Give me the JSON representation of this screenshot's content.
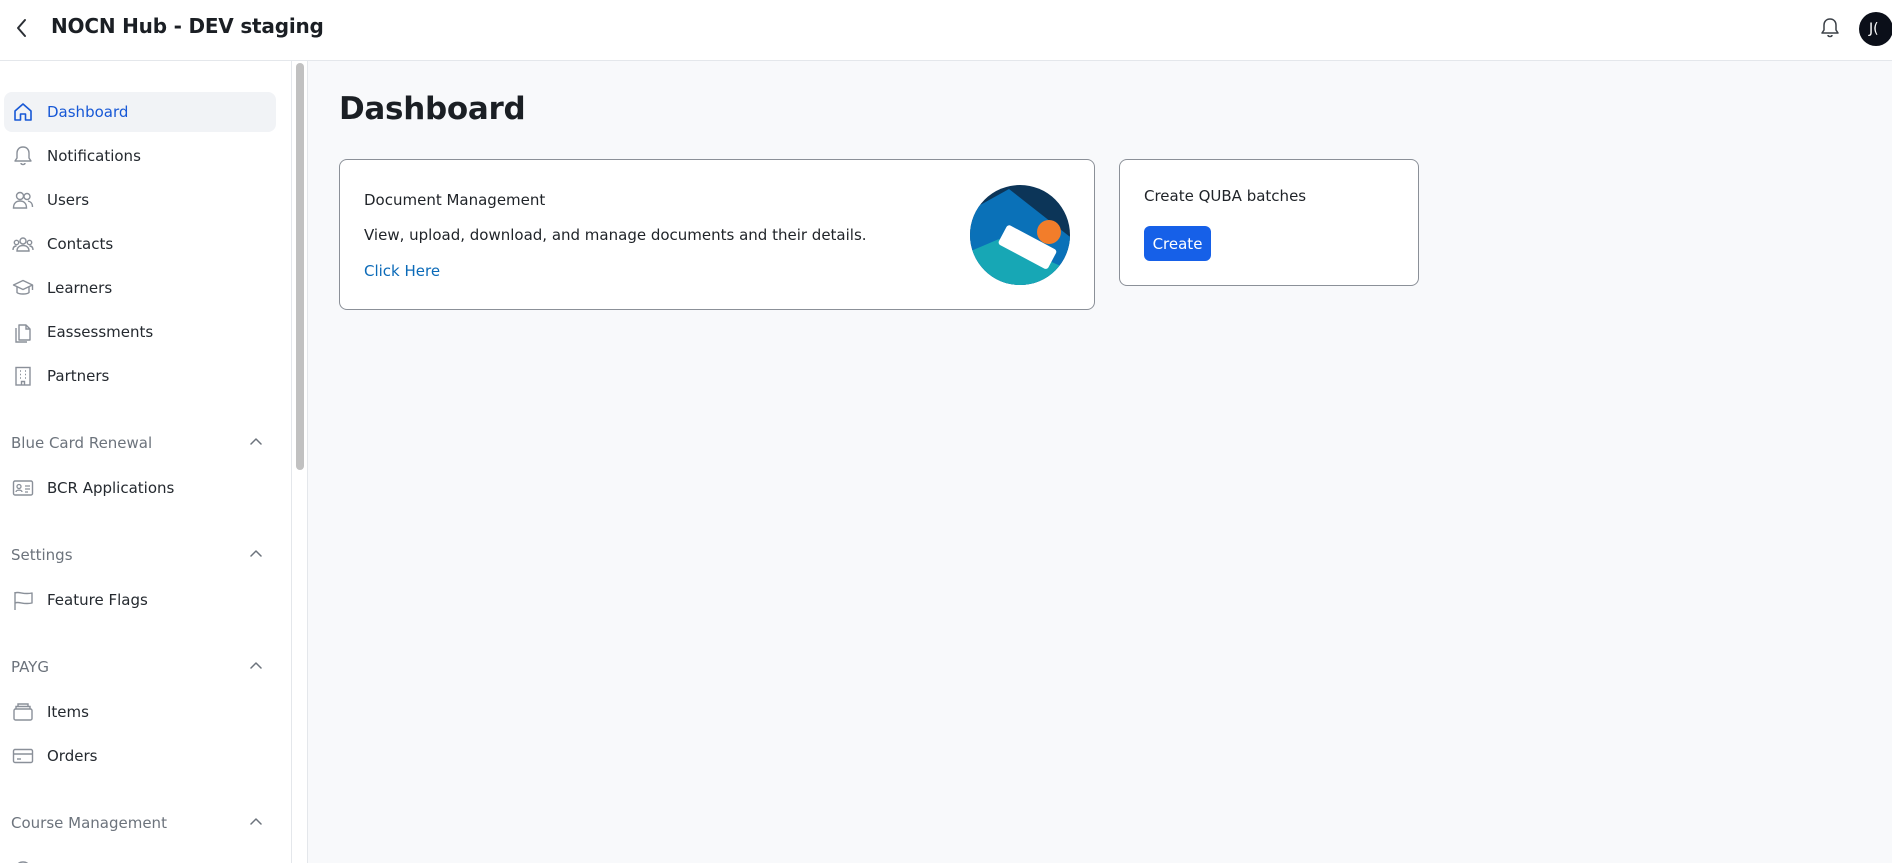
{
  "header": {
    "title": "NOCN Hub - DEV staging",
    "avatar_initials": "J("
  },
  "sidebar": {
    "main_items": [
      {
        "label": "Dashboard",
        "icon": "home-icon",
        "active": true
      },
      {
        "label": "Notifications",
        "icon": "bell-icon"
      },
      {
        "label": "Users",
        "icon": "users-icon"
      },
      {
        "label": "Contacts",
        "icon": "contacts-icon"
      },
      {
        "label": "Learners",
        "icon": "graduation-cap-icon"
      },
      {
        "label": "Eassessments",
        "icon": "documents-icon"
      },
      {
        "label": "Partners",
        "icon": "building-icon"
      }
    ],
    "sections": [
      {
        "title": "Blue Card Renewal",
        "items": [
          {
            "label": "BCR Applications",
            "icon": "id-card-icon"
          }
        ]
      },
      {
        "title": "Settings",
        "items": [
          {
            "label": "Feature Flags",
            "icon": "flag-icon"
          }
        ]
      },
      {
        "title": "PAYG",
        "items": [
          {
            "label": "Items",
            "icon": "stack-icon"
          },
          {
            "label": "Orders",
            "icon": "credit-card-icon"
          }
        ]
      },
      {
        "title": "Course Management",
        "items": []
      }
    ]
  },
  "main": {
    "title": "Dashboard",
    "document_card": {
      "title": "Document Management",
      "description": "View, upload, download, and manage documents and their details.",
      "link": "Click Here"
    },
    "quba_card": {
      "title": "Create QUBA batches",
      "button": "Create"
    }
  },
  "colors": {
    "accent": "#1660e8",
    "active_text": "#1758d6",
    "link": "#0b6ab8",
    "illustration_dark": "#0c3558",
    "illustration_blue": "#0a71b8",
    "illustration_teal": "#17a7b5",
    "illustration_orange": "#f27d2a"
  }
}
